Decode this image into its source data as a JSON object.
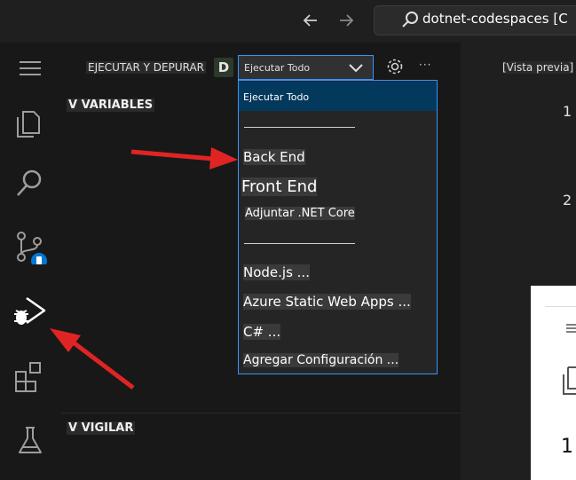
{
  "titlebar": {
    "back_icon": "arrow-left-icon",
    "forward_icon": "arrow-right-icon",
    "search_text": "dotnet-codespaces [C"
  },
  "activitybar": {
    "items": [
      "menu-icon",
      "explorer-icon",
      "search-icon",
      "source-control-icon",
      "run-debug-icon",
      "extensions-icon",
      "testing-icon"
    ]
  },
  "run_debug": {
    "title": "EJECUTAR Y DEPURAR",
    "badge": "D",
    "selected_config": "Ejecutar Todo",
    "more": "···"
  },
  "dropdown": {
    "items": [
      {
        "label": "Ejecutar Todo",
        "selected": true
      },
      {
        "label": "Back End"
      },
      {
        "label": "Front End"
      },
      {
        "label": "Adjuntar .NET Core"
      },
      {
        "label": "Node.js ..."
      },
      {
        "label": "Azure Static Web Apps ..."
      },
      {
        "label": "C# ..."
      },
      {
        "label": "Agregar Configuración ..."
      }
    ]
  },
  "sections": {
    "variables": "V VARIABLES",
    "watch": "V VIGILAR"
  },
  "editor": {
    "tab_label": "[Vista previa]",
    "line1": "1",
    "line2": "2",
    "panel_line": "1"
  },
  "colors": {
    "accent": "#3794ff",
    "annotation_arrow": "#e02424",
    "selected_item": "#04395e"
  }
}
